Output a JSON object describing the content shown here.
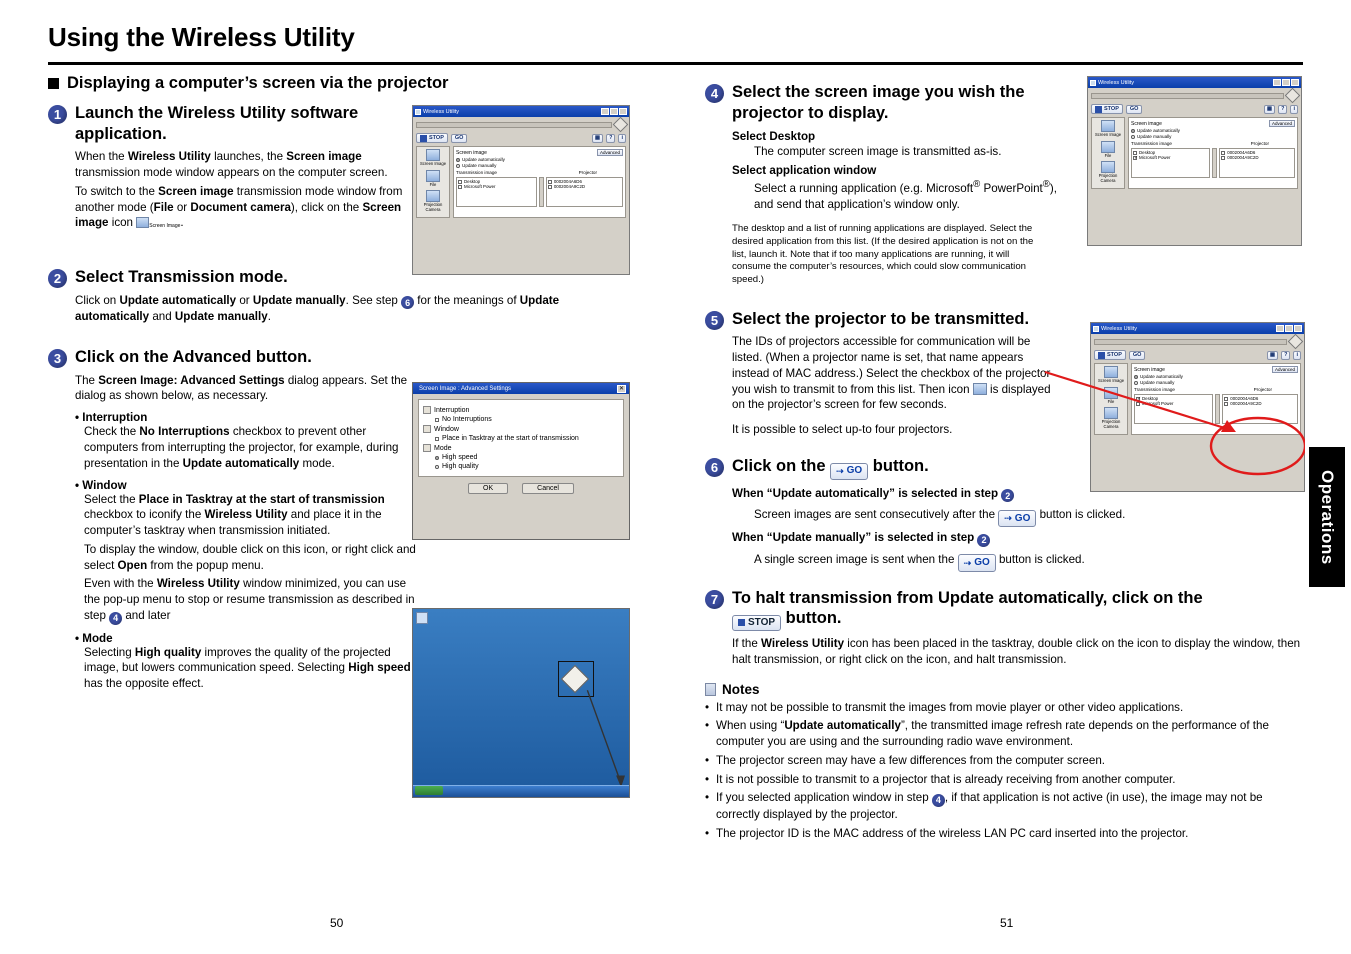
{
  "doc": {
    "title": "Using the Wireless Utility",
    "side_tab": "Operations",
    "page_left": "50",
    "page_right": "51"
  },
  "left": {
    "section_heading": "Displaying a computer’s screen via the projector",
    "step1": {
      "num": "1",
      "title": "Launch the Wireless Utility software application.",
      "p1_a": "When the ",
      "p1_b": "Wireless Utility",
      "p1_c": " launches, the ",
      "p1_d": "Screen image",
      "p1_e": " transmission mode window appears on the computer screen.",
      "p2_a": "To switch to the ",
      "p2_b": "Screen image",
      "p2_c": " transmission mode window from another mode (",
      "p2_d": "File",
      "p2_e": " or ",
      "p2_f": "Document camera",
      "p2_g": "), click on the ",
      "p2_h": "Screen image",
      "p2_i": " icon",
      "p2_j": "."
    },
    "step2": {
      "num": "2",
      "title": "Select Transmission mode.",
      "p_a": "Click on ",
      "p_b": "Update automatically",
      "p_c": " or ",
      "p_d": "Update manually",
      "p_e": ". See step ",
      "p_ref": "6",
      "p_f": " for the meanings of ",
      "p_g": "Update automatically",
      "p_h": " and ",
      "p_i": "Update manually",
      "p_j": "."
    },
    "step3": {
      "num": "3",
      "title": "Click on the Advanced button.",
      "p_a": "The ",
      "p_b": "Screen Image: Advanced Settings",
      "p_c": " dialog appears. Set the dialog as shown below, as necessary.",
      "b1_title": "Interruption",
      "b1_a": "Check the ",
      "b1_b": "No Interruptions",
      "b1_c": " checkbox to prevent other computers from interrupting the projector, for example, during presentation in the ",
      "b1_d": "Update automatically",
      "b1_e": " mode.",
      "b2_title": "Window",
      "b2_a": "Select the ",
      "b2_b": "Place in Tasktray at the start of transmission",
      "b2_c": " checkbox to iconify the ",
      "b2_d": "Wireless Utility",
      "b2_e": " and place it in the computer’s tasktray when transmission initiated.",
      "b2_f": "To display the window, double click on this icon, or right click and select ",
      "b2_g": "Open",
      "b2_h": " from the popup menu.",
      "b2_i": "Even with the ",
      "b2_j": "Wireless Utility",
      "b2_k": " window minimized, you can use the pop-up menu to stop or resume transmission as described in step ",
      "b2_ref": "4",
      "b2_l": " and later",
      "b3_title": "Mode",
      "b3_a": "Selecting ",
      "b3_b": "High quality",
      "b3_c": " improves the quality of the projected image, but lowers communication speed. Selecting ",
      "b3_d": "High speed",
      "b3_e": " has the opposite effect."
    }
  },
  "right": {
    "step4": {
      "num": "4",
      "title": "Select the screen image you wish the projector to display.",
      "h1": "Select Desktop",
      "h1_body": "The computer screen image is transmitted as-is.",
      "h2": "Select application window",
      "h2_body_a": "Select a running application (e.g. Microsoft",
      "h2_sup1": "®",
      "h2_body_b": " PowerPoint",
      "h2_sup2": "®",
      "h2_body_c": "), and send that application’s window only.",
      "note": "The desktop and a list of running applications are displayed. Select the desired application from this list. (If the desired application is not on the list, launch it. Note that if too many applications are running, it will consume the computer’s resources, which could slow communication speed.)"
    },
    "step5": {
      "num": "5",
      "title": "Select the projector to be transmitted.",
      "p_a": "The IDs of projectors accessible for communication will be listed. (When a projector name is set, that name appears instead of MAC address.) Select the checkbox of the projector you wish to transmit to from this list. Then icon ",
      "p_b": " is displayed on the projector’s screen for few seconds.",
      "p2": "It is possible to select up-to four projectors."
    },
    "step6": {
      "num": "6",
      "title_a": "Click on the ",
      "title_btn": "GO",
      "title_b": " button.",
      "h1_a": "When “Update automatically” is selected in step ",
      "h1_ref": "2",
      "h1_body_a": "Screen images are sent consecutively after the ",
      "h1_body_b": " button is clicked.",
      "h2_a": "When “Update manually” is selected in step ",
      "h2_ref": "2",
      "h2_body_a": "A single screen image is sent when the ",
      "h2_body_b": " button is clicked."
    },
    "step7": {
      "num": "7",
      "title_a": "To halt transmission from Update automatically, click on the ",
      "title_btn": "STOP",
      "title_b": " button.",
      "p_a": "If the ",
      "p_b": "Wireless Utility",
      "p_c": " icon has been placed in the tasktray, double click on the icon to display the window, then halt transmission, or right click on the icon, and halt transmission."
    },
    "notes": {
      "heading": "Notes",
      "items": [
        "It may not be possible to transmit the images from movie player or other video applications.",
        "When using “Update automatically”, the transmitted image refresh rate depends on the performance of the computer you are using and the surrounding radio wave environment.",
        "The projector screen may have a few differences from the computer screen.",
        "It is not possible to transmit to a projector that is already receiving from another computer.",
        "If you selected application window in step 4, if that application is not active (in use), the image may not be correctly displayed by the projector.",
        "The projector ID is the MAC address of the wireless LAN PC card inserted into the projector."
      ],
      "item2_quoted": "Update automatically",
      "item5_a": "If you selected application window in step ",
      "item5_ref": "4",
      "item5_b": ", if that application is not active (in use), the image may not be correctly displayed by the projector."
    }
  },
  "screenshots": {
    "wireless_utility": {
      "title": "Wireless Utility",
      "stop_label": "STOP",
      "go_label": "GO",
      "screen_image_label": "Screen image",
      "advanced_label": "Advanced",
      "radio_auto": "Update automatically",
      "radio_manual": "Update manually",
      "transmission_image": "Transmission image",
      "projector_label": "Projector",
      "item_desktop": "Desktop",
      "item_ppt": "Microsoft Power",
      "mac1": "0002004A6D6",
      "mac2": "0002004A9C2D",
      "side_screen_image": "Screen Image",
      "side_file": "File",
      "side_doc_camera": "Projection Camera"
    },
    "advanced_dialog": {
      "title": "Screen Image : Advanced Settings",
      "interruption": "Interruption",
      "no_interruptions": "No Interruptions",
      "window": "Window",
      "place_in_tasktray": "Place in Tasktray at the start of transmission",
      "mode": "Mode",
      "high_speed": "High speed",
      "high_quality": "High quality",
      "ok": "OK",
      "cancel": "Cancel"
    }
  }
}
